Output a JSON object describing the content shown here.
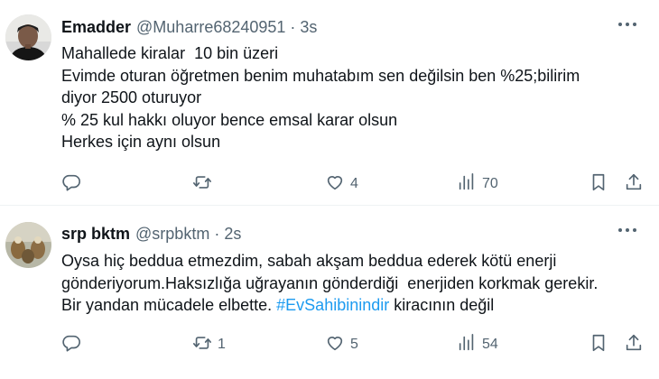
{
  "tweets": [
    {
      "name": "Emadder",
      "handle": "@Muharre68240951",
      "separator": "·",
      "time": "3s",
      "text": "Mahallede kiralar  10 bin üzeri\nEvimde oturan öğretmen benim muhatabım sen değilsin ben %25;bilirim\ndiyor 2500 oturuyor\n% 25 kul hakkı oluyor bence emsal karar olsun\nHerkes için aynı olsun",
      "text_before_hashtag": "",
      "hashtag": "",
      "text_after_hashtag": "",
      "replies": "",
      "retweets": "",
      "likes": "4",
      "views": "70",
      "avatar_icon": "avatar-photo"
    },
    {
      "name": "srp bktm",
      "handle": "@srpbktm",
      "separator": "·",
      "time": "2s",
      "text_before_hashtag": "Oysa hiç beddua etmezdim, sabah akşam beddua ederek kötü enerji\ngönderiyorum.Haksızlığa uğrayanın gönderdiği  enerjiden korkmak gerekir.\nBir yandan mücadele elbette. ",
      "hashtag": "#EvSahibinindir",
      "text_after_hashtag": " kiracının değil",
      "replies": "",
      "retweets": "1",
      "likes": "5",
      "views": "54",
      "avatar_icon": "avatar-photo"
    }
  ],
  "icons": {
    "reply": "reply-icon",
    "retweet": "retweet-icon",
    "like": "heart-icon",
    "views": "views-icon",
    "bookmark": "bookmark-icon",
    "share": "share-icon",
    "more": "more-icon"
  },
  "colors": {
    "text": "#0f1419",
    "secondary": "#536471",
    "hashtag": "#1d9bf0",
    "divider": "#eff3f4"
  }
}
